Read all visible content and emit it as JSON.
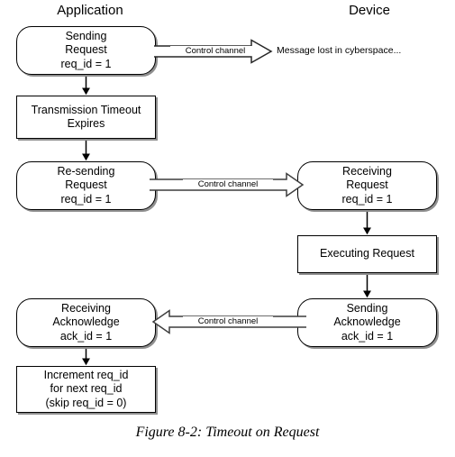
{
  "figure": {
    "caption": "Figure 8-2: Timeout on Request",
    "columns": {
      "left": "Application",
      "right": "Device"
    },
    "colors": {
      "background": "#ffffff",
      "stroke": "#000000",
      "shadow": "#8f8f8f",
      "arrow_body": "#595959"
    },
    "nodes": {
      "sending_request": {
        "line1": "Sending",
        "line2": "Request",
        "line3": "req_id = 1"
      },
      "transmission_timeout": {
        "line1": "Transmission Timeout",
        "line2": "Expires"
      },
      "resending_request": {
        "line1": "Re-sending",
        "line2": "Request",
        "line3": "req_id = 1"
      },
      "receiving_request": {
        "line1": "Receiving",
        "line2": "Request",
        "line3": "req_id = 1"
      },
      "executing_request": {
        "line1": "Executing Request"
      },
      "sending_acknowledge": {
        "line1": "Sending",
        "line2": "Acknowledge",
        "line3": "ack_id = 1"
      },
      "receiving_acknowledge": {
        "line1": "Receiving",
        "line2": "Acknowledge",
        "line3": "ack_id = 1"
      },
      "increment_reqid": {
        "line1": "Increment req_id",
        "line2": "for next req_id",
        "line3": "(skip req_id = 0)"
      }
    },
    "arrows": {
      "lost_message_label": "Control channel",
      "lost_message_note": "Message lost in cyberspace...",
      "request_label": "Control channel",
      "acknowledge_label": "Control channel"
    }
  }
}
